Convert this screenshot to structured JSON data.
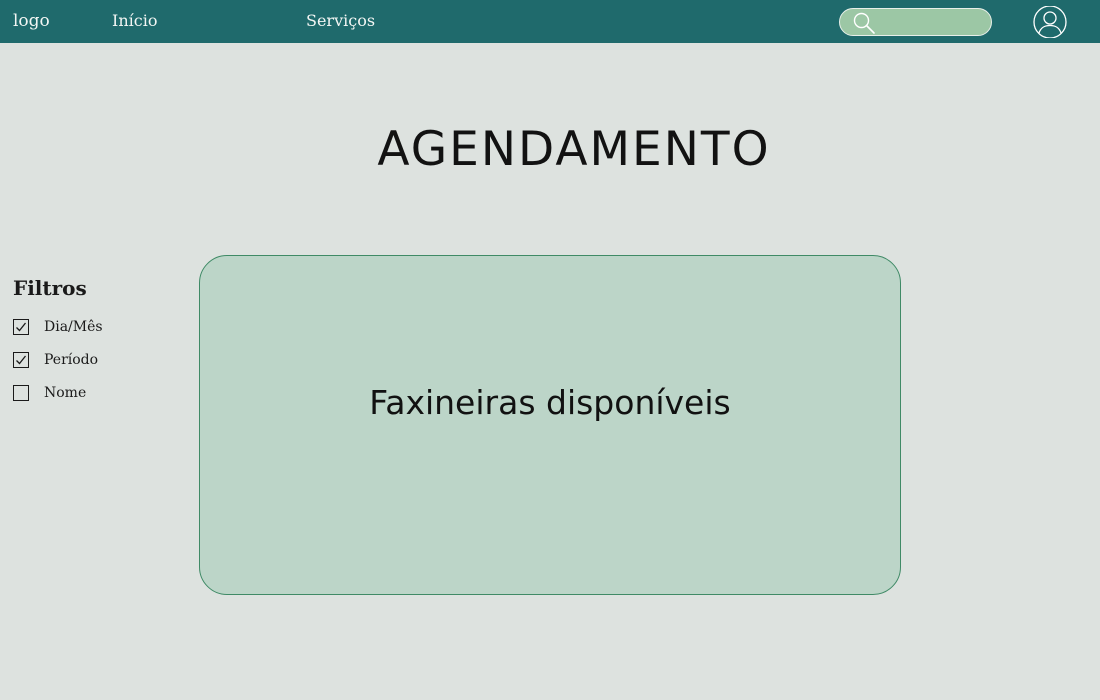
{
  "header": {
    "logo": "logo",
    "nav": {
      "home_label": "Início",
      "services_label": "Serviços"
    },
    "search": {
      "placeholder": "",
      "icon": "search-icon"
    },
    "user_icon": "user-avatar-icon"
  },
  "main": {
    "title": "AGENDAMENTO",
    "filters": {
      "title": "Filtros",
      "items": [
        {
          "label": "Dia/Mês",
          "checked": true
        },
        {
          "label": "Período",
          "checked": true
        },
        {
          "label": "Nome",
          "checked": false
        }
      ]
    },
    "panel": {
      "label": "Faxineiras disponíveis"
    }
  },
  "colors": {
    "topbar": "#1f6a6c",
    "background": "#dde2df",
    "search_fill": "#9cc7a5",
    "panel_fill": "#bcd5c8",
    "panel_border": "#3f8a66"
  }
}
